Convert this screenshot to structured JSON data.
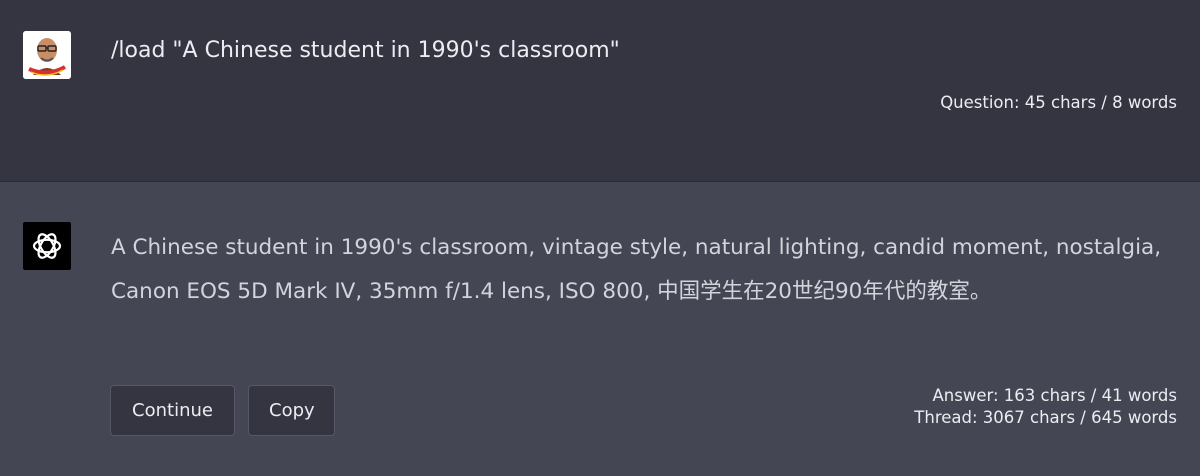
{
  "question": {
    "text": "/load \"A Chinese student in 1990's classroom\"",
    "stats": "Question: 45 chars / 8 words"
  },
  "answer": {
    "text": "A Chinese student in 1990's classroom, vintage style, natural lighting, candid moment, nostalgia, Canon EOS 5D Mark IV, 35mm f/1.4 lens, ISO 800, 中国学生在20世纪90年代的教室。",
    "stats_answer": "Answer: 163 chars / 41 words",
    "stats_thread": "Thread: 3067 chars / 645 words"
  },
  "buttons": {
    "continue_label": "Continue",
    "copy_label": "Copy"
  },
  "colors": {
    "user_bg": "#343541",
    "assistant_bg": "#444654",
    "text": "#ececf1"
  },
  "icons": {
    "user_avatar": "user-avatar-icon",
    "assistant_avatar": "openai-logo-icon"
  }
}
